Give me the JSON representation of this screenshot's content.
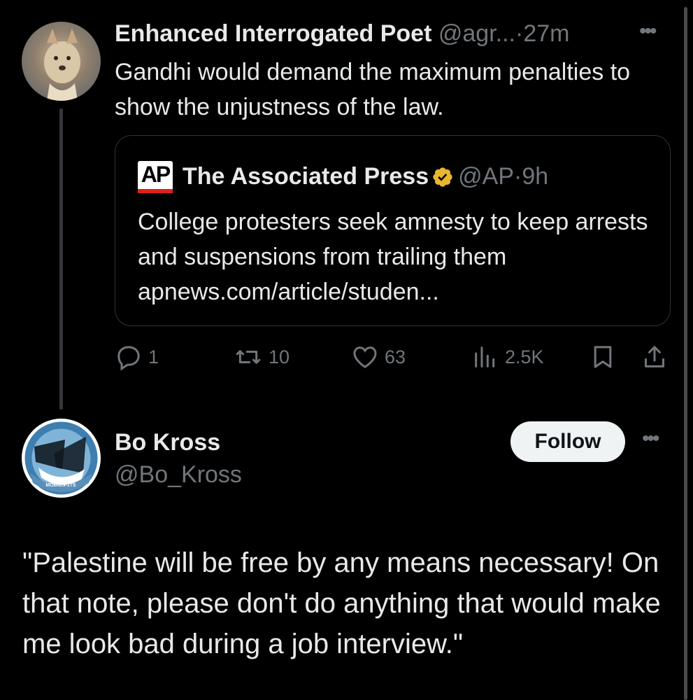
{
  "tweet1": {
    "author_name": "Enhanced Interrogated Poet",
    "author_handle": "@agr...",
    "separator": "·",
    "time": "27m",
    "more_icon": "ellipsis-icon",
    "text": "Gandhi would demand the maximum penalties to show the unjustness of the law.",
    "quote": {
      "logo_text": "AP",
      "author_name": "The Associated Press",
      "verified_icon": "verified-badge-icon",
      "author_handle": "@AP",
      "separator": "·",
      "time": "9h",
      "text": "College protesters seek amnesty to keep arrests and suspensions from trailing them",
      "link": "apnews.com/article/studen..."
    },
    "actions": {
      "replies": "1",
      "reposts": "10",
      "likes": "63",
      "views": "2.5K"
    }
  },
  "tweet2": {
    "author_name": "Bo Kross",
    "author_handle": "@Bo_Kross",
    "follow_label": "Follow",
    "more_icon": "ellipsis-icon",
    "text": "\"Palestine will be free by any means necessary! On that note, please don't do anything that would make me look bad during a job interview.\""
  },
  "colors": {
    "background": "#000000",
    "text": "#e7e9ea",
    "muted": "#71767b",
    "border": "#2f3336",
    "verified": "#e8b730",
    "ap_red": "#e0201b"
  }
}
